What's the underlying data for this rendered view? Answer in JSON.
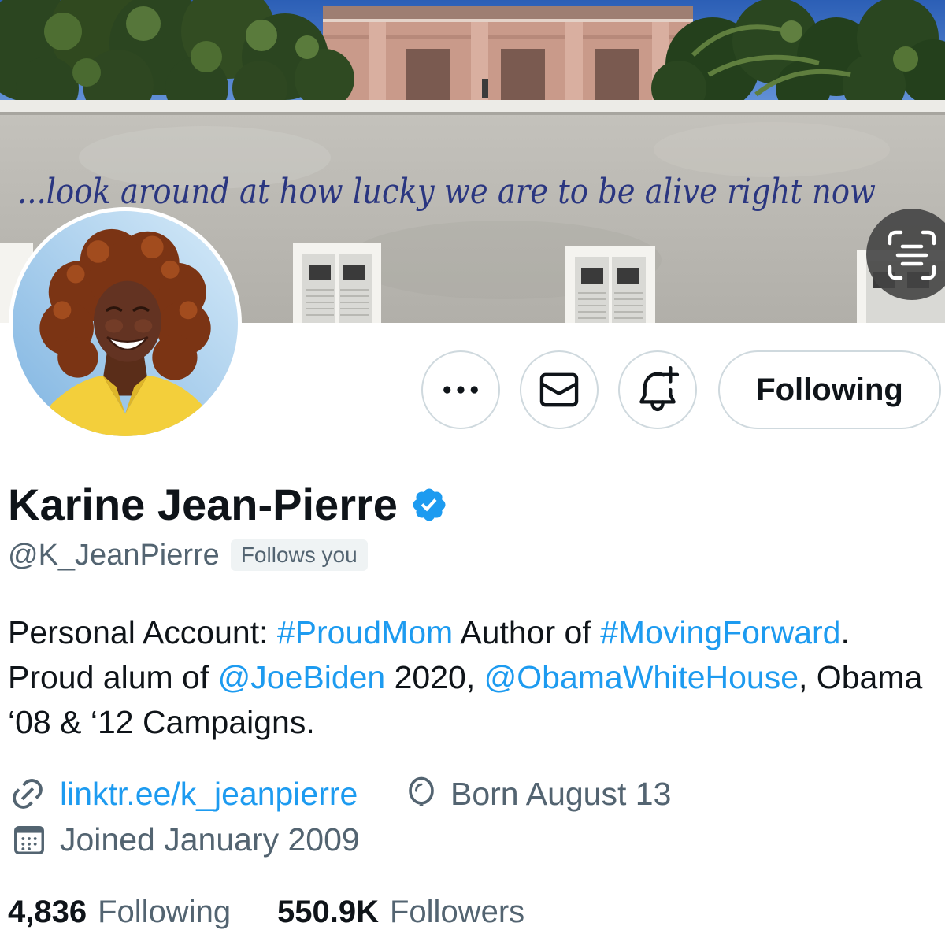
{
  "banner": {
    "mural_text": "...look around at how lucky we are to be alive right now",
    "live_text_icon": "live-text-scan-icon"
  },
  "actions": {
    "more_icon": "more-options-icon",
    "message_icon": "mail-icon",
    "notifications_icon": "bell-plus-icon",
    "follow_button_label": "Following"
  },
  "profile": {
    "name": "Karine Jean-Pierre",
    "verified_icon": "verified-badge-icon",
    "handle": "@K_JeanPierre",
    "follows_you_badge": "Follows you",
    "bio": {
      "lines": [
        [
          {
            "plain": "Personal Account: "
          },
          {
            "hashtag": "#ProudMom"
          },
          {
            "plain": " Author of "
          },
          {
            "hashtag": "#MovingForward"
          },
          {
            "plain": "."
          }
        ],
        [
          {
            "plain": "Proud alum of "
          },
          {
            "mention": "@JoeBiden"
          },
          {
            "plain": " 2020, "
          },
          {
            "mention": "@ObamaWhiteHouse"
          },
          {
            "plain": ", Obama"
          }
        ],
        [
          {
            "plain": "‘08 & ‘12 Campaigns."
          }
        ]
      ]
    },
    "meta": {
      "link_icon": "link-icon",
      "website": "linktr.ee/k_jeanpierre",
      "birthday_icon": "balloon-icon",
      "birthday": "Born August 13",
      "joined_icon": "calendar-icon",
      "joined": "Joined January 2009"
    },
    "stats": {
      "following_count": "4,836",
      "following_label": "Following",
      "followers_count": "550.9K",
      "followers_label": "Followers"
    }
  },
  "colors": {
    "accent": "#1d9bf0",
    "text": "#0f1419",
    "muted": "#536471",
    "border": "#cfd9de",
    "badge_bg": "#eff3f4",
    "mural_ink": "#2a3680"
  }
}
